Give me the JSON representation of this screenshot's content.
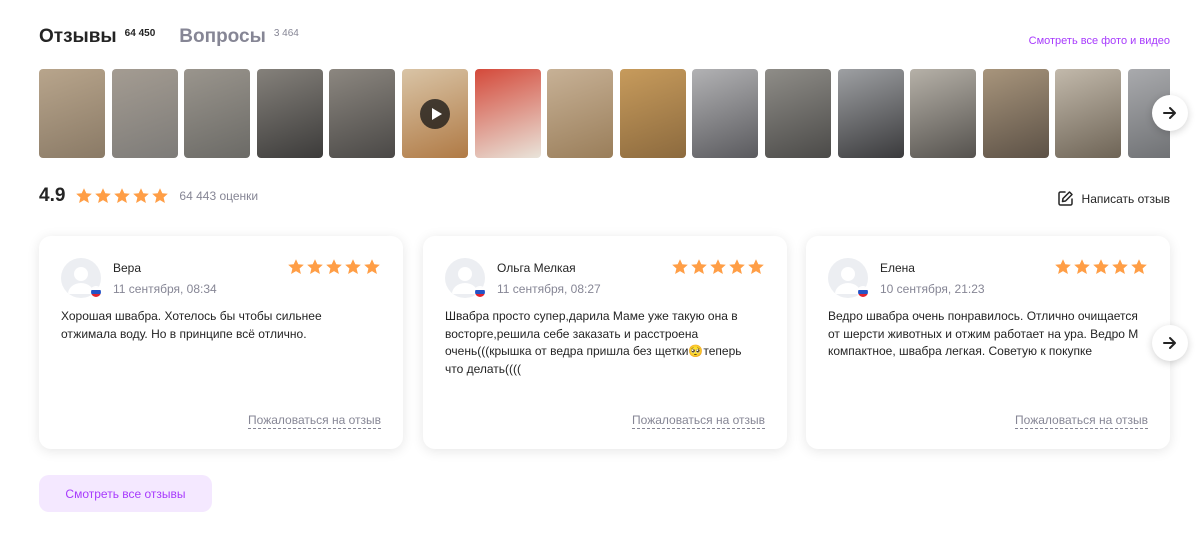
{
  "tabs": [
    {
      "label": "Отзывы",
      "count": "64 450",
      "active": true
    },
    {
      "label": "Вопросы",
      "count": "3 464",
      "active": false
    }
  ],
  "media_link": "Смотреть все фото и видео",
  "gallery": {
    "thumbs": [
      {
        "colors": [
          "#8a7a66",
          "#b8a58c"
        ],
        "video": false
      },
      {
        "colors": [
          "#7d7b78",
          "#a49c92"
        ],
        "video": false
      },
      {
        "colors": [
          "#6b6a66",
          "#9a958d"
        ],
        "video": false
      },
      {
        "colors": [
          "#3c3b3a",
          "#85817b"
        ],
        "video": false
      },
      {
        "colors": [
          "#4a4846",
          "#8c8780"
        ],
        "video": false
      },
      {
        "colors": [
          "#b07a45",
          "#d9c4a6"
        ],
        "video": true
      },
      {
        "colors": [
          "#e9e4da",
          "#d4493a"
        ],
        "video": false
      },
      {
        "colors": [
          "#9a7e5a",
          "#c7b196"
        ],
        "video": false
      },
      {
        "colors": [
          "#8c6a3e",
          "#c79b5c"
        ],
        "video": false
      },
      {
        "colors": [
          "#5a5a5e",
          "#b2b2b4"
        ],
        "video": false
      },
      {
        "colors": [
          "#4b4a48",
          "#8f8d88"
        ],
        "video": false
      },
      {
        "colors": [
          "#3a3a3c",
          "#9ea0a3"
        ],
        "video": false
      },
      {
        "colors": [
          "#55524e",
          "#b6b1a8"
        ],
        "video": false
      },
      {
        "colors": [
          "#5c5146",
          "#a8957c"
        ],
        "video": false
      },
      {
        "colors": [
          "#6e6456",
          "#c2b9ab"
        ],
        "video": false
      },
      {
        "colors": [
          "#6b6d70",
          "#a9aaad"
        ],
        "video": false
      }
    ],
    "next_icon": "arrow-right-icon"
  },
  "rating": {
    "value": "4.9",
    "stars": 5,
    "count": "64 443 оценки"
  },
  "write_review": {
    "label": "Написать отзыв",
    "icon": "pencil-square-icon"
  },
  "reviews": [
    {
      "author": "Вера",
      "date": "11 сентября, 08:34",
      "stars": 5,
      "text": "Хорошая швабра. Хотелось бы чтобы сильнее отжимала воду. Но в принципе всё отлично.",
      "complain": "Пожаловаться на отзыв"
    },
    {
      "author": "Ольга Мелкая",
      "date": "11 сентября, 08:27",
      "stars": 5,
      "text": "Швабра просто супер,дарила Маме уже такую она в восторге,решила себе заказать и расстроена очень(((крышка от ведра пришла без щетки🥺теперь что делать((((",
      "complain": "Пожаловаться на отзыв"
    },
    {
      "author": "Елена",
      "date": "10 сентября, 21:23",
      "stars": 5,
      "text": "Ведро швабра очень понравилось. Отлично очищается от шерсти животных и отжим работает на ура. Ведро М компактное, швабра легкая. Советую к покупке",
      "complain": "Пожаловаться на отзыв"
    }
  ],
  "all_reviews_button": "Смотреть все отзывы",
  "colors": {
    "accent": "#a73afd",
    "star": "#ff9e46",
    "muted": "#868695",
    "button_bg": "#f4e8ff"
  }
}
